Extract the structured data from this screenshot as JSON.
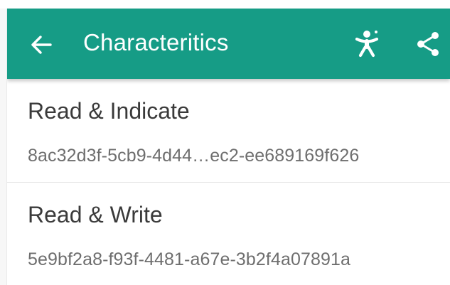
{
  "appbar": {
    "title": "Characteritics",
    "color": "#169c86",
    "back_icon": "arrow-left-icon",
    "accessibility_icon": "accessibility-icon",
    "share_icon": "share-icon"
  },
  "characteristics": [
    {
      "title": "Read & Indicate",
      "uuid": "8ac32d3f-5cb9-4d44…ec2-ee689169f626"
    },
    {
      "title": "Read & Write",
      "uuid": "5e9bf2a8-f93f-4481-a67e-3b2f4a07891a"
    }
  ]
}
